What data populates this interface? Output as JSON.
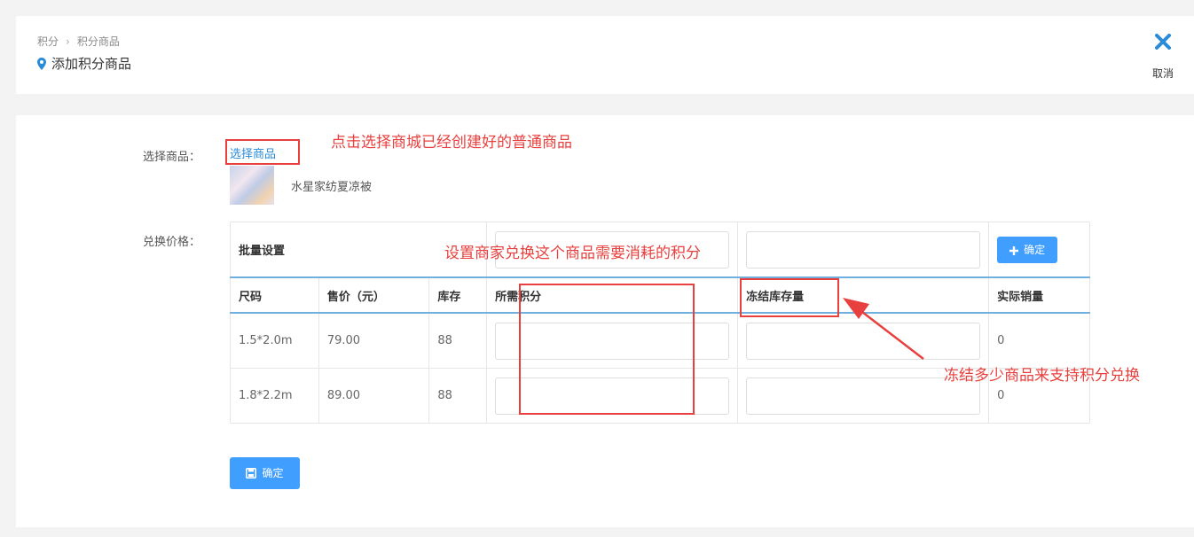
{
  "header": {
    "breadcrumb": [
      "积分",
      "积分商品"
    ],
    "title": "添加积分商品",
    "cancel_label": "取消"
  },
  "form": {
    "select_product_label": "选择商品：",
    "select_product_link": "选择商品",
    "product_name": "水星家纺夏凉被",
    "exchange_price_label": "兑换价格："
  },
  "table": {
    "batch_label": "批量设置",
    "batch_confirm": "确定",
    "headers": [
      "尺码",
      "售价（元）",
      "库存",
      "所需积分",
      "冻结库存量",
      "实际销量"
    ],
    "rows": [
      {
        "size": "1.5*2.0m",
        "price": "79.00",
        "stock": "88",
        "sales": "0"
      },
      {
        "size": "1.8*2.2m",
        "price": "89.00",
        "stock": "88",
        "sales": "0"
      }
    ]
  },
  "save_button": "确定",
  "annotations": {
    "select_hint": "点击选择商城已经创建好的普通商品",
    "points_hint": "设置商家兑换这个商品需要消耗的积分",
    "freeze_hint": "冻结多少商品来支持积分兑换"
  },
  "colors": {
    "accent": "#409eff",
    "link": "#2a8bd8",
    "annotation": "#e8403e"
  }
}
